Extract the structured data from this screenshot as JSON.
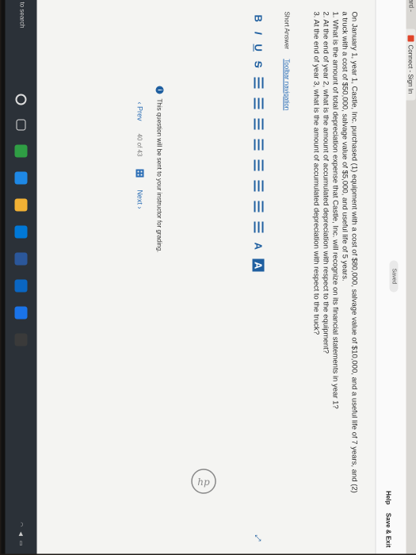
{
  "browser": {
    "prev_tab_label": "ard -",
    "tab_label": "Connect - Sign In"
  },
  "header": {
    "saved_label": "Saved",
    "help_label": "Help",
    "save_exit_label": "Save & Exit"
  },
  "question": {
    "line1": "On January 1, year 1, Castle, Inc. purchased (1) equipment with a cost of $80,000, salvage value of $10,000, and a useful life of 7 years, and (2)",
    "line2": "a truck with a cost of $50,000, salvage value of $5,000, and useful life of 5 years.",
    "line3": "1. What is the amount of total depreciation expense that Castle, Inc. will recognize on its financial statements in year 1?",
    "line4": "2. At the end of year 2, what is the amount of accumulated depreciation with respect to the equipment?",
    "line5": "3. At the end of year 3, what is the amount of accumulated depreciation with respect to the truck?"
  },
  "answer": {
    "type_label": "Short Answer",
    "toolbar_nav_label": "Toolbar navigation"
  },
  "toolbar": {
    "bold": "B",
    "italic": "I",
    "underline": "U",
    "strike": "S",
    "font_color": "A",
    "highlight": "A"
  },
  "footer": {
    "grading_note": "This question will be sent to your instructor for grading.",
    "prev_label": "Prev",
    "page_of": "40 of 43",
    "next_label": "Next"
  },
  "taskbar": {
    "search_placeholder": "to search"
  },
  "brand": "hp"
}
